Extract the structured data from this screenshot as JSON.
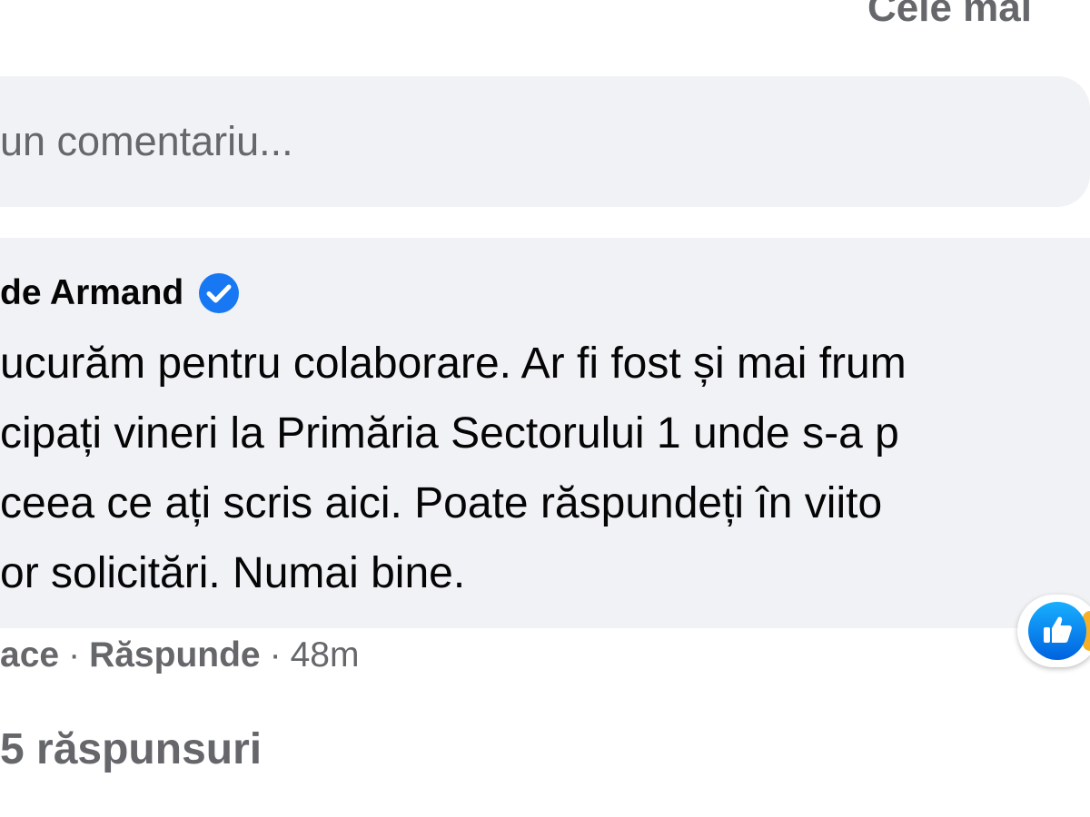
{
  "sort": {
    "label": "Cele mai"
  },
  "comment_input": {
    "placeholder": "un comentariu..."
  },
  "comment": {
    "author": "de Armand",
    "verified": true,
    "verified_icon": "verified-badge-icon",
    "lines": [
      "ucurăm pentru colaborare. Ar fi fost și mai frum",
      "cipați vineri la Primăria Sectorului 1 unde s-a p",
      " ceea ce ați scris aici. Poate răspundeți în viito",
      "or solicitări. Numai bine."
    ],
    "reaction_icon": "like-icon",
    "actions": {
      "like": "ace",
      "separator": "·",
      "reply": "Răspunde",
      "time": "48m"
    },
    "replies_label": "5 răspunsuri"
  },
  "colors": {
    "bubble": "#f0f2f5",
    "secondary_text": "#65676b",
    "primary_text": "#050505",
    "accent": "#1877f2"
  }
}
